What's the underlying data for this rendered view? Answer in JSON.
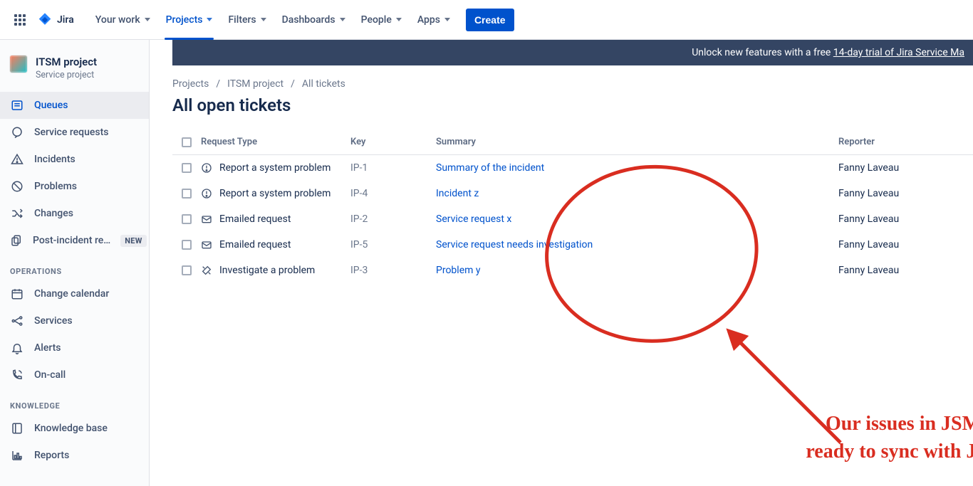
{
  "app": {
    "product": "Jira"
  },
  "topnav": {
    "items": [
      {
        "label": "Your work"
      },
      {
        "label": "Projects",
        "active": true
      },
      {
        "label": "Filters"
      },
      {
        "label": "Dashboards"
      },
      {
        "label": "People"
      },
      {
        "label": "Apps"
      }
    ],
    "create_label": "Create"
  },
  "sidebar": {
    "project_title": "ITSM project",
    "project_subtitle": "Service project",
    "items": [
      {
        "icon": "list-icon",
        "label": "Queues",
        "selected": true
      },
      {
        "icon": "chat-icon",
        "label": "Service requests"
      },
      {
        "icon": "warning-icon",
        "label": "Incidents"
      },
      {
        "icon": "block-icon",
        "label": "Problems"
      },
      {
        "icon": "shuffle-icon",
        "label": "Changes"
      },
      {
        "icon": "copy-icon",
        "label": "Post-incident re…",
        "badge": "NEW"
      }
    ],
    "section_ops": "OPERATIONS",
    "ops_items": [
      {
        "icon": "calendar-icon",
        "label": "Change calendar"
      },
      {
        "icon": "services-icon",
        "label": "Services"
      },
      {
        "icon": "bell-icon",
        "label": "Alerts"
      },
      {
        "icon": "oncall-icon",
        "label": "On-call"
      }
    ],
    "section_knowledge": "KNOWLEDGE",
    "knowledge_items": [
      {
        "icon": "book-icon",
        "label": "Knowledge base"
      },
      {
        "icon": "report-icon",
        "label": "Reports"
      }
    ]
  },
  "banner": {
    "prefix": "Unlock new features with a free ",
    "link": "14-day trial of Jira Service Ma"
  },
  "breadcrumbs": {
    "c0": "Projects",
    "c1": "ITSM project",
    "c2": "All tickets"
  },
  "page_title": "All open tickets",
  "table": {
    "headers": {
      "request_type": "Request Type",
      "key": "Key",
      "summary": "Summary",
      "reporter": "Reporter"
    },
    "rows": [
      {
        "icon": "warning-circle-icon",
        "request_type": "Report a system problem",
        "key": "IP-1",
        "summary": "Summary of the incident",
        "reporter": "Fanny Laveau"
      },
      {
        "icon": "warning-circle-icon",
        "request_type": "Report a system problem",
        "key": "IP-4",
        "summary": "Incident z",
        "reporter": "Fanny Laveau"
      },
      {
        "icon": "mail-icon",
        "request_type": "Emailed request",
        "key": "IP-2",
        "summary": "Service request x",
        "reporter": "Fanny Laveau"
      },
      {
        "icon": "mail-icon",
        "request_type": "Emailed request",
        "key": "IP-5",
        "summary": "Service request needs investigation",
        "reporter": "Fanny Laveau"
      },
      {
        "icon": "tools-icon",
        "request_type": "Investigate a problem",
        "key": "IP-3",
        "summary": "Problem y",
        "reporter": "Fanny Laveau"
      }
    ]
  },
  "annotation": {
    "line1": "Our issues in JSM",
    "line2": "ready to sync with Jira"
  }
}
